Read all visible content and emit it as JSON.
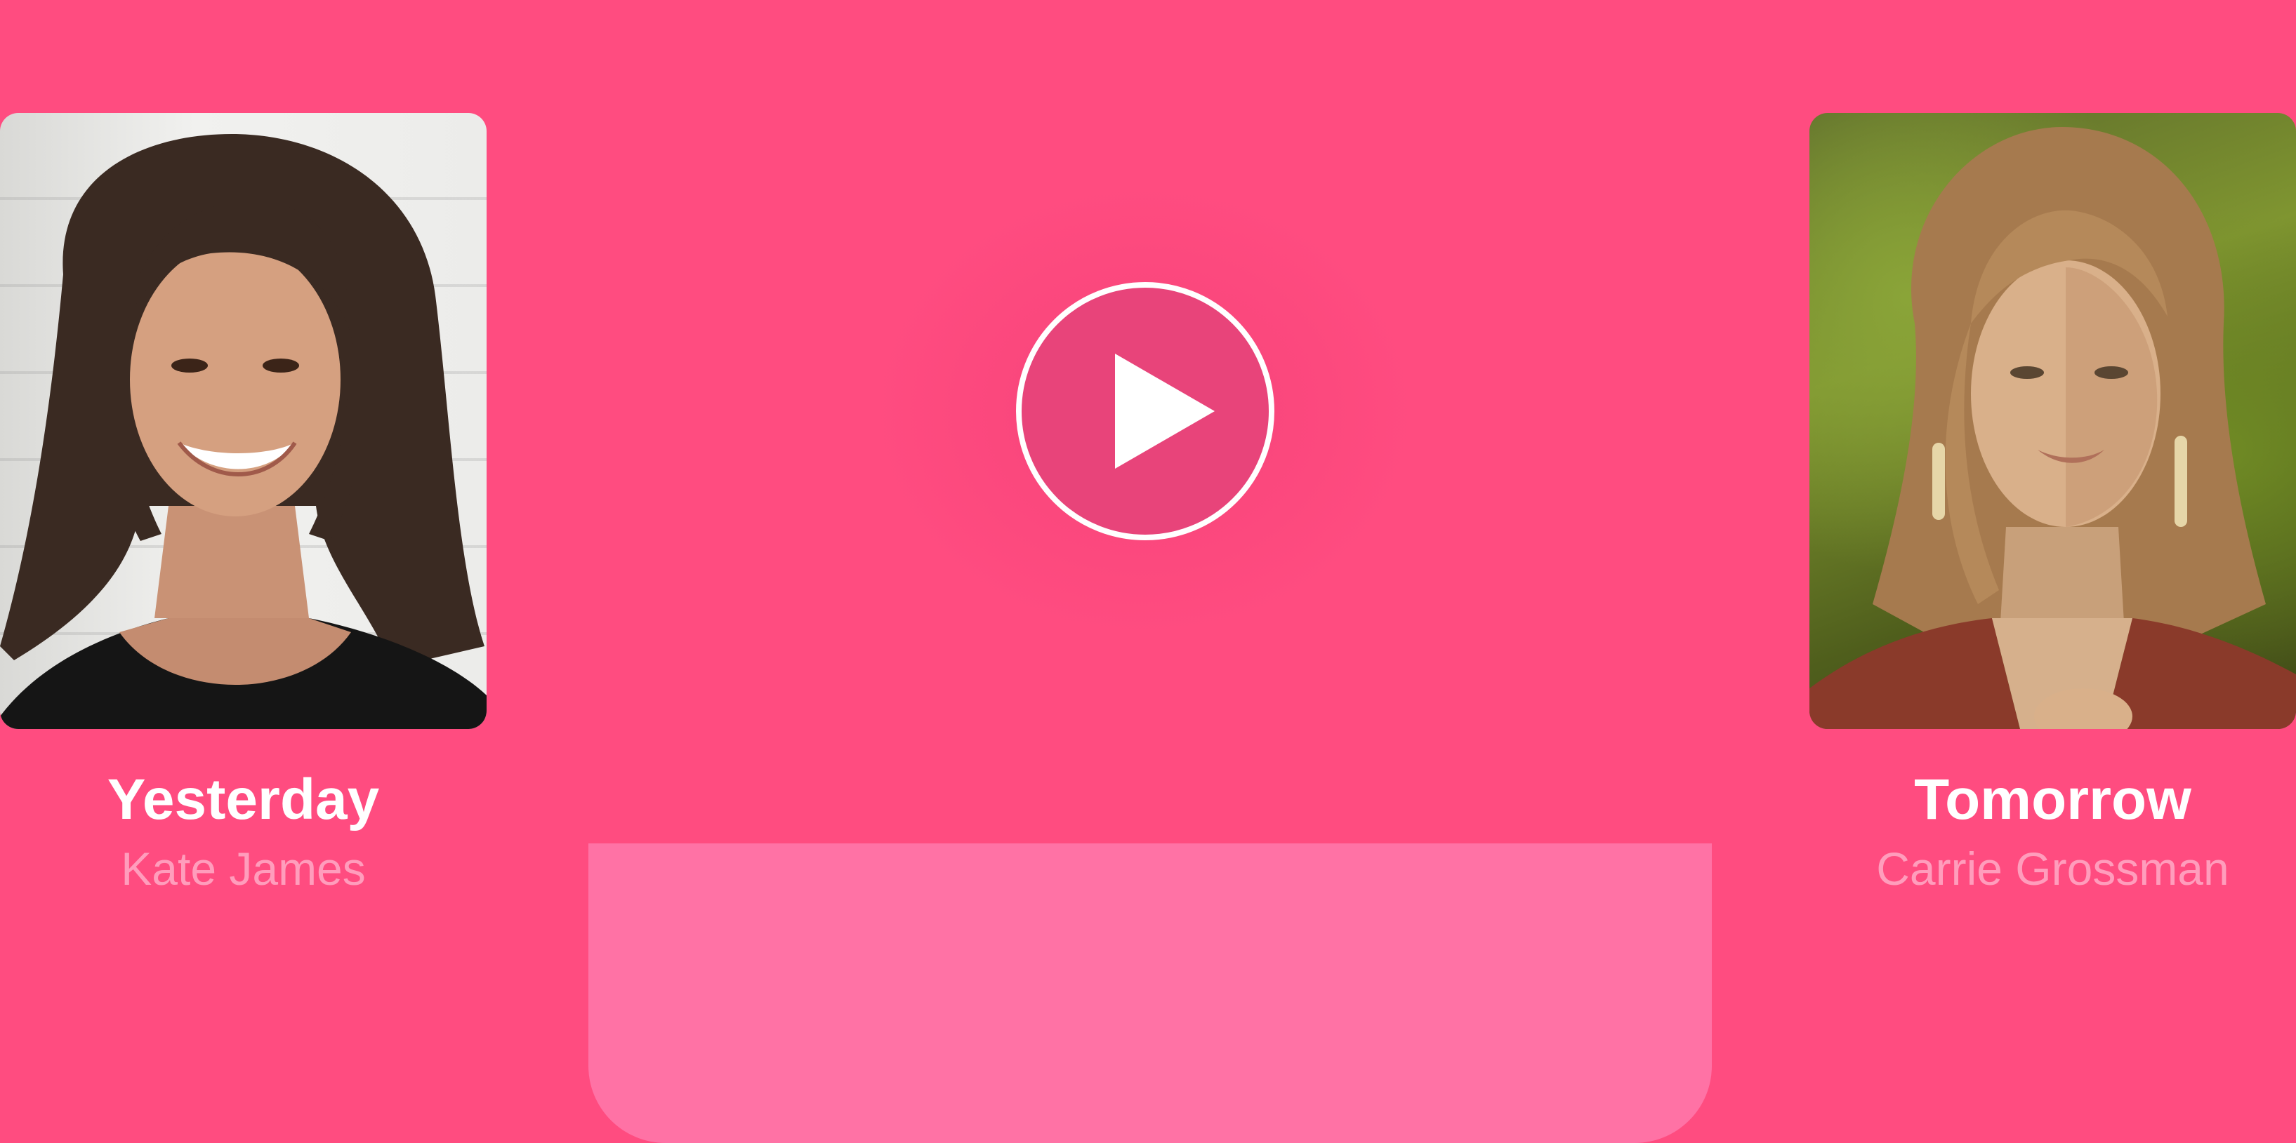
{
  "colors": {
    "background": "#FF4C80",
    "panel": "#FF72A5",
    "title_text": "#FFFFFF",
    "subtitle_text": "#FF9DBC"
  },
  "left_card": {
    "title": "Yesterday",
    "name": "Kate James",
    "photo_icon": "portrait-photo"
  },
  "right_card": {
    "title": "Tomorrow",
    "name": "Carrie Grossman",
    "photo_icon": "portrait-photo"
  },
  "player": {
    "icon": "play-circle-icon"
  }
}
